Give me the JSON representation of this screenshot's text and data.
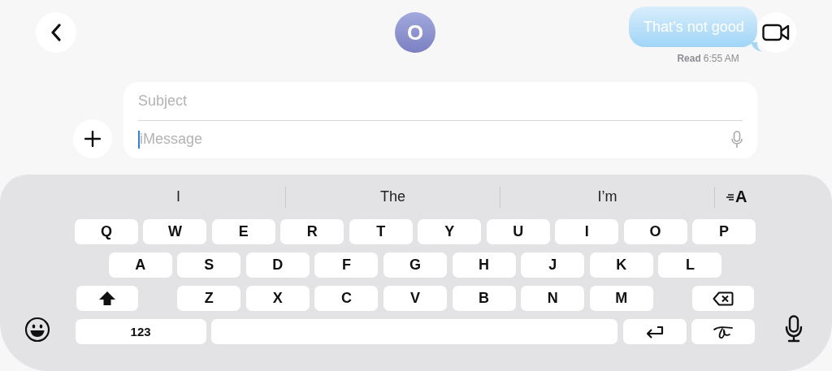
{
  "header": {
    "avatar_initial": "O"
  },
  "message": {
    "text": "That’s not good",
    "status": "Read",
    "time": "6:55 AM"
  },
  "compose": {
    "subject_placeholder": "Subject",
    "message_placeholder": "iMessage"
  },
  "keyboard": {
    "suggestions": [
      "I",
      "The",
      "I’m"
    ],
    "format_label": "A",
    "rows": [
      [
        {
          "kind": "letter",
          "label": "Q"
        },
        {
          "kind": "letter",
          "label": "W"
        },
        {
          "kind": "letter",
          "label": "E"
        },
        {
          "kind": "letter",
          "label": "R"
        },
        {
          "kind": "letter",
          "label": "T"
        },
        {
          "kind": "letter",
          "label": "Y"
        },
        {
          "kind": "letter",
          "label": "U"
        },
        {
          "kind": "letter",
          "label": "I"
        },
        {
          "kind": "letter",
          "label": "O"
        },
        {
          "kind": "letter",
          "label": "P"
        }
      ],
      [
        {
          "kind": "letter",
          "label": "A"
        },
        {
          "kind": "letter",
          "label": "S"
        },
        {
          "kind": "letter",
          "label": "D"
        },
        {
          "kind": "letter",
          "label": "F"
        },
        {
          "kind": "letter",
          "label": "G"
        },
        {
          "kind": "letter",
          "label": "H"
        },
        {
          "kind": "letter",
          "label": "J"
        },
        {
          "kind": "letter",
          "label": "K"
        },
        {
          "kind": "letter",
          "label": "L"
        }
      ],
      [
        {
          "kind": "shift"
        },
        {
          "kind": "letter",
          "label": "Z"
        },
        {
          "kind": "letter",
          "label": "X"
        },
        {
          "kind": "letter",
          "label": "C"
        },
        {
          "kind": "letter",
          "label": "V"
        },
        {
          "kind": "letter",
          "label": "B"
        },
        {
          "kind": "letter",
          "label": "N"
        },
        {
          "kind": "letter",
          "label": "M"
        },
        {
          "kind": "delete"
        }
      ],
      [
        {
          "kind": "numbers",
          "label": "123"
        },
        {
          "kind": "space"
        },
        {
          "kind": "return"
        },
        {
          "kind": "handwriting"
        }
      ]
    ]
  }
}
